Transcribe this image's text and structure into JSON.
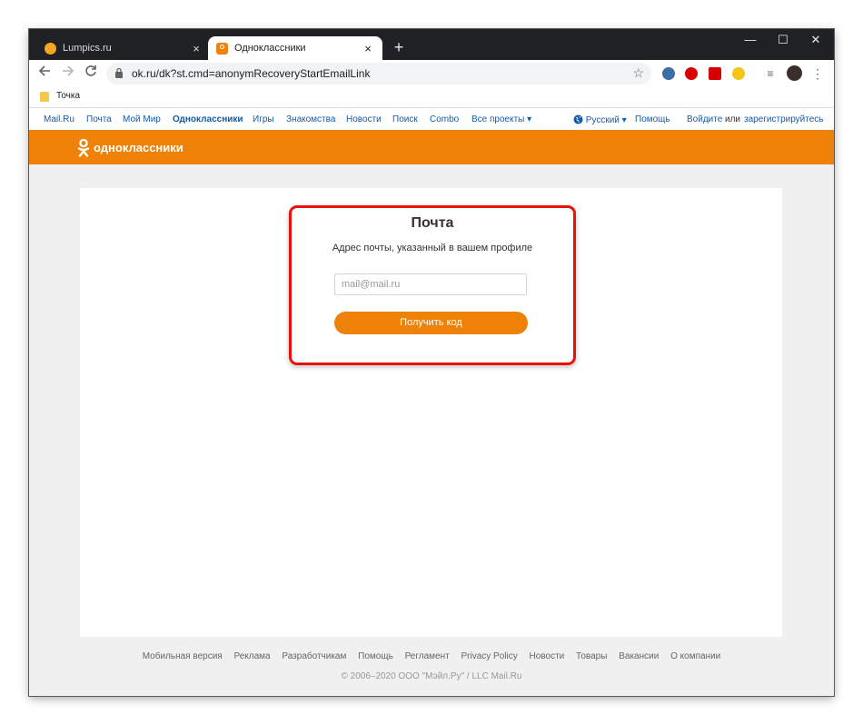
{
  "browser": {
    "tabs": [
      {
        "title": "Lumpics.ru",
        "close": "×"
      },
      {
        "title": "Одноклассники",
        "close": "×"
      }
    ],
    "new_tab": "+",
    "window_controls": {
      "minimize": "—",
      "maximize": "☐",
      "close": "✕"
    },
    "url": "ok.ru/dk?st.cmd=anonymRecoveryStartEmailLink",
    "bookmarks": [
      {
        "label": "Точка"
      }
    ]
  },
  "portal_nav": {
    "links": [
      "Mail.Ru",
      "Почта",
      "Мой Мир",
      "Одноклассники",
      "Игры",
      "Знакомства",
      "Новости",
      "Поиск",
      "Combo",
      "Все проекты ▾"
    ],
    "language": "Русский ▾",
    "help": "Помощь",
    "login": "Войдите",
    "or": "или",
    "register": "зарегистрируйтесь"
  },
  "site": {
    "name": "одноклассники",
    "brand_color": "#ee8208"
  },
  "form": {
    "title": "Почта",
    "description": "Адрес почты, указанный в вашем профиле",
    "email_placeholder": "mail@mail.ru",
    "email_value": "",
    "submit_label": "Получить код"
  },
  "footer": {
    "links": [
      "Мобильная версия",
      "Реклама",
      "Разработчикам",
      "Помощь",
      "Регламент",
      "Privacy Policy",
      "Новости",
      "Товары",
      "Вакансии",
      "О компании"
    ],
    "copyright": "© 2006–2020 ООО \"Мэйл.Ру\" / LLC Mail.Ru"
  },
  "annotation": {
    "highlight_color": "#e8120c"
  }
}
